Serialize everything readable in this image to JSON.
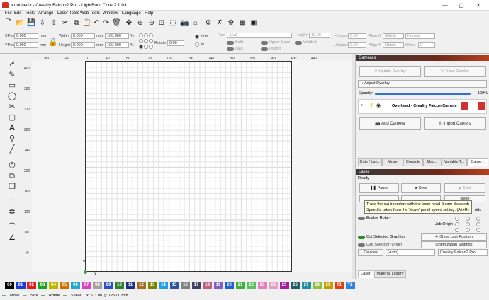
{
  "window": {
    "title": "<untitled> - Creality Falcon2 Pro - LightBurn Core 2.1.03",
    "minimize": "—",
    "maximize": "▢",
    "close": "✕"
  },
  "menu": [
    "File",
    "Edit",
    "Tools",
    "Arrange",
    "Laser Tools",
    "Web Tools",
    "Window",
    "Language",
    "Help"
  ],
  "props": {
    "xpos_label": "XPos",
    "xpos": "0.000",
    "ypos_label": "YPos",
    "ypos": "0.000",
    "unit_mm": "mm",
    "width_label": "Width",
    "width": "0.000",
    "height_label": "Height",
    "height": "0.000",
    "scale_w": "100.000",
    "scale_h": "100.000",
    "pct": "%",
    "rotate_label": "Rotate",
    "rotate": "0.00",
    "mm_radio": "mm",
    "in_radio": "in",
    "font_label": "Font",
    "font": "Arial",
    "bold": "Bold",
    "italic": "Italic",
    "upper": "Upper Case",
    "distort": "Distort",
    "welded": "Welded",
    "height2_label": "Height",
    "height2": "12.00",
    "hspace_label": "HSpace",
    "hspace": "0.00",
    "vspace_label": "VSpace",
    "vspace": "0.00",
    "alignx_label": "Align X",
    "alignx": "Middle",
    "aligny_label": "Align Y",
    "aligny": "Middle",
    "normal": "Normal",
    "offset_label": "Offset",
    "offset": "0"
  },
  "ruler": {
    "top": [
      "-80",
      "-40",
      "0",
      "40",
      "80",
      "120",
      "160",
      "200",
      "240",
      "280",
      "320",
      "360",
      "400",
      "440"
    ],
    "left": [
      "440",
      "400",
      "360",
      "320",
      "280",
      "240",
      "200",
      "160",
      "120",
      "80",
      "40",
      "0",
      "-40"
    ],
    "xlabel": "X",
    "ylabel": "Y"
  },
  "cameras": {
    "header": "Cameras",
    "update_overlay": "Update Overlay",
    "trace_overlay": "Trace Overlay",
    "adjust_overlay": "Adjust Overlay",
    "opacity_label": "Opacity:",
    "opacity": "100%",
    "opacity_value": 1.0,
    "camera_name": "Overhead - Creality Falcon Camera",
    "add_camera": "Add Camera",
    "import_camera": "Import Camera"
  },
  "tabs": [
    "Cuts / Lay...",
    "Move",
    "Console",
    "Mac...",
    "Variable T...",
    "Came..."
  ],
  "laser": {
    "header": "Laser",
    "status": "Ready",
    "pause": "Pause",
    "stop": "Stop",
    "start": "Start",
    "node": "Node",
    "grids": "rids",
    "enable_rotary": "Enable Rotary",
    "job_origin": "Job Origin",
    "cut_selected": "Cut Selected Graphics",
    "use_selection_origin": "Use Selection Origin",
    "show_last_position": "Show Last Position",
    "optimization_settings": "Optimization Settings",
    "devices": "Devices",
    "auto": "(Auto)",
    "device_name": "Creality Falcon2 Pro"
  },
  "tooltip": {
    "line1": "Trace the cut boundary with the laser head (beam disabled)",
    "line2": "Speed is taken from the 'Move' panel speed setting. (Alt+R)"
  },
  "bottom_tabs": [
    "Laser",
    "Material Library"
  ],
  "palette": [
    {
      "label": "00",
      "color": "#000000"
    },
    {
      "label": "01",
      "color": "#1a3bd8"
    },
    {
      "label": "02",
      "color": "#e02020"
    },
    {
      "label": "03",
      "color": "#20a020"
    },
    {
      "label": "04",
      "color": "#b8b800"
    },
    {
      "label": "05",
      "color": "#d07000"
    },
    {
      "label": "06",
      "color": "#20a8c8"
    },
    {
      "label": "07",
      "color": "#e040c0"
    },
    {
      "label": "08",
      "color": "#a0a0a0"
    },
    {
      "label": "09",
      "color": "#3050c0"
    },
    {
      "label": "10",
      "color": "#308030"
    },
    {
      "label": "11",
      "color": "#203080"
    },
    {
      "label": "12",
      "color": "#a07020"
    },
    {
      "label": "13",
      "color": "#808000"
    },
    {
      "label": "14",
      "color": "#20a0e0"
    },
    {
      "label": "15",
      "color": "#3050a0"
    },
    {
      "label": "16",
      "color": "#808080"
    },
    {
      "label": "17",
      "color": "#404060"
    },
    {
      "label": "18",
      "color": "#c06080"
    },
    {
      "label": "19",
      "color": "#8060c0"
    },
    {
      "label": "20",
      "color": "#2060d0"
    },
    {
      "label": "21",
      "color": "#40b040"
    },
    {
      "label": "22",
      "color": "#60c060"
    },
    {
      "label": "23",
      "color": "#e080c0"
    },
    {
      "label": "24",
      "color": "#e0a0c0"
    },
    {
      "label": "25",
      "color": "#a020a0"
    },
    {
      "label": "26",
      "color": "#206060"
    },
    {
      "label": "27",
      "color": "#2090a0"
    },
    {
      "label": "28",
      "color": "#90c040"
    },
    {
      "label": "29",
      "color": "#c0a000"
    },
    {
      "label": "T1",
      "color": "#e04010"
    },
    {
      "label": "T2",
      "color": "#3080e0"
    }
  ],
  "status": {
    "move": "Move",
    "size": "Size",
    "rotate": "Rotate",
    "shear": "Shear",
    "coords": "x: 511.00, y: 126.00 mm"
  }
}
